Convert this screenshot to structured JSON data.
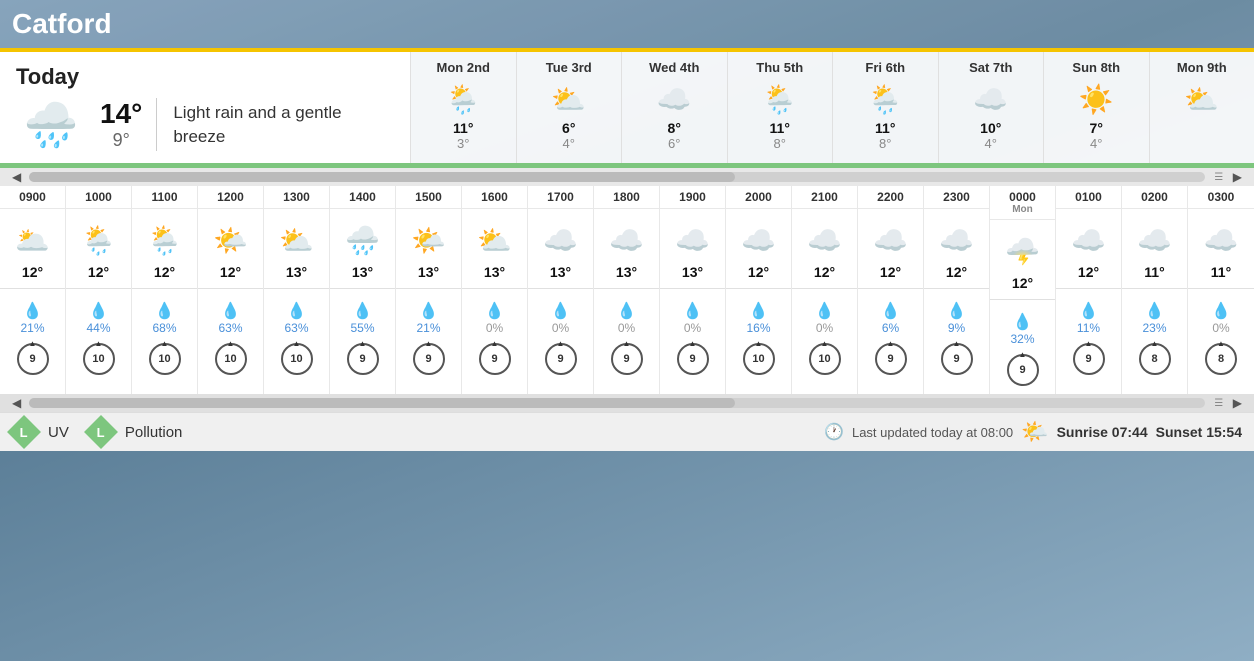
{
  "location": "Catford",
  "today": {
    "label": "Today",
    "high": "14°",
    "low": "9°",
    "description": "Light rain and a gentle breeze",
    "icon": "🌧️"
  },
  "forecast": [
    {
      "day": "Mon 2nd",
      "icon": "🌦️",
      "high": "11°",
      "low": "3°"
    },
    {
      "day": "Tue 3rd",
      "icon": "⛅",
      "high": "6°",
      "low": "4°"
    },
    {
      "day": "Wed 4th",
      "icon": "☁️",
      "high": "8°",
      "low": "6°"
    },
    {
      "day": "Thu 5th",
      "icon": "🌦️",
      "high": "11°",
      "low": "8°"
    },
    {
      "day": "Fri 6th",
      "icon": "🌦️",
      "high": "11°",
      "low": "8°"
    },
    {
      "day": "Sat 7th",
      "icon": "☁️",
      "high": "10°",
      "low": "4°"
    },
    {
      "day": "Sun 8th",
      "icon": "☀️",
      "high": "7°",
      "low": "4°"
    },
    {
      "day": "Mon 9th",
      "icon": "⛅",
      "high": "",
      "low": ""
    }
  ],
  "hourly": [
    {
      "time": "0900",
      "sublabel": "",
      "icon": "🌥️",
      "temp": "12°",
      "tempLow": "",
      "precipPct": "21%",
      "precipColor": "blue",
      "wind": "9"
    },
    {
      "time": "1000",
      "sublabel": "",
      "icon": "🌦️",
      "temp": "12°",
      "tempLow": "",
      "precipPct": "44%",
      "precipColor": "blue",
      "wind": "10"
    },
    {
      "time": "1100",
      "sublabel": "",
      "icon": "🌦️",
      "temp": "12°",
      "tempLow": "",
      "precipPct": "68%",
      "precipColor": "blue",
      "wind": "10"
    },
    {
      "time": "1200",
      "sublabel": "",
      "icon": "🌤️",
      "temp": "12°",
      "tempLow": "",
      "precipPct": "63%",
      "precipColor": "blue",
      "wind": "10"
    },
    {
      "time": "1300",
      "sublabel": "",
      "icon": "⛅",
      "temp": "13°",
      "tempLow": "",
      "precipPct": "63%",
      "precipColor": "blue",
      "wind": "10"
    },
    {
      "time": "1400",
      "sublabel": "",
      "icon": "🌧️",
      "temp": "13°",
      "tempLow": "",
      "precipPct": "55%",
      "precipColor": "blue",
      "wind": "9"
    },
    {
      "time": "1500",
      "sublabel": "",
      "icon": "🌤️",
      "temp": "13°",
      "tempLow": "",
      "precipPct": "21%",
      "precipColor": "blue",
      "wind": "9"
    },
    {
      "time": "1600",
      "sublabel": "",
      "icon": "⛅",
      "temp": "13°",
      "tempLow": "",
      "precipPct": "0%",
      "precipColor": "gray",
      "wind": "9"
    },
    {
      "time": "1700",
      "sublabel": "",
      "icon": "☁️",
      "temp": "13°",
      "tempLow": "",
      "precipPct": "0%",
      "precipColor": "gray",
      "wind": "9"
    },
    {
      "time": "1800",
      "sublabel": "",
      "icon": "☁️",
      "temp": "13°",
      "tempLow": "",
      "precipPct": "0%",
      "precipColor": "gray",
      "wind": "9"
    },
    {
      "time": "1900",
      "sublabel": "",
      "icon": "☁️",
      "temp": "13°",
      "tempLow": "",
      "precipPct": "0%",
      "precipColor": "gray",
      "wind": "9"
    },
    {
      "time": "2000",
      "sublabel": "",
      "icon": "☁️",
      "temp": "12°",
      "tempLow": "",
      "precipPct": "16%",
      "precipColor": "blue",
      "wind": "10"
    },
    {
      "time": "2100",
      "sublabel": "",
      "icon": "☁️",
      "temp": "12°",
      "tempLow": "",
      "precipPct": "0%",
      "precipColor": "gray",
      "wind": "10"
    },
    {
      "time": "2200",
      "sublabel": "",
      "icon": "☁️",
      "temp": "12°",
      "tempLow": "",
      "precipPct": "6%",
      "precipColor": "blue",
      "wind": "9"
    },
    {
      "time": "2300",
      "sublabel": "",
      "icon": "☁️",
      "temp": "12°",
      "tempLow": "",
      "precipPct": "9%",
      "precipColor": "blue",
      "wind": "9"
    },
    {
      "time": "0000",
      "sublabel": "Mon",
      "icon": "🌩️",
      "temp": "12°",
      "tempLow": "",
      "precipPct": "32%",
      "precipColor": "blue",
      "wind": "9"
    },
    {
      "time": "0100",
      "sublabel": "",
      "icon": "☁️",
      "temp": "12°",
      "tempLow": "",
      "precipPct": "11%",
      "precipColor": "blue",
      "wind": "9"
    },
    {
      "time": "0200",
      "sublabel": "",
      "icon": "☁️",
      "temp": "11°",
      "tempLow": "",
      "precipPct": "23%",
      "precipColor": "blue",
      "wind": "8"
    },
    {
      "time": "0300",
      "sublabel": "",
      "icon": "☁️",
      "temp": "11°",
      "tempLow": "",
      "precipPct": "0%",
      "precipColor": "gray",
      "wind": "8"
    }
  ],
  "footer": {
    "uv_label": "UV",
    "uv_level": "L",
    "pollution_label": "Pollution",
    "pollution_level": "L",
    "last_updated": "Last updated today at 08:00",
    "sunrise": "Sunrise 07:44",
    "sunset": "Sunset 15:54"
  }
}
